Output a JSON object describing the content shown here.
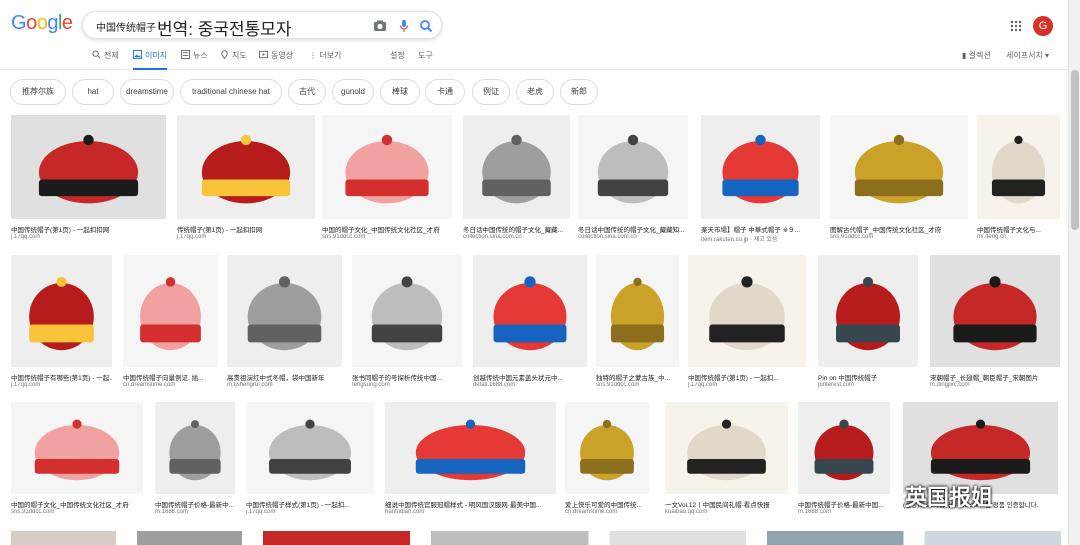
{
  "header": {
    "logo": "Google",
    "query_small": "中国传统帽子",
    "query_big": "번역: 중국전통모자",
    "avatar": "G",
    "icons": {
      "camera": "camera-icon",
      "mic": "mic-icon",
      "search": "search-icon",
      "apps": "apps-grid-icon"
    }
  },
  "tabs": [
    {
      "label": "전체",
      "icon": "search-icon"
    },
    {
      "label": "이미지",
      "icon": "image-icon"
    },
    {
      "label": "뉴스",
      "icon": "news-icon"
    },
    {
      "label": "지도",
      "icon": "pin-icon"
    },
    {
      "label": "동영상",
      "icon": "video-icon"
    },
    {
      "label": "더보기",
      "icon": "more-icon"
    }
  ],
  "settings_label": "설정",
  "tools_label": "도구",
  "collections_label": "컬렉션",
  "safesearch_label": "세이프서치 ▾",
  "chips": [
    "推荐尔族",
    "hat",
    "dreamstime",
    "traditional chinese hat",
    "古代",
    "gunold",
    "棒球",
    "卡通",
    "例证",
    "老虎",
    "新郎"
  ],
  "row1": [
    {
      "cap": "中国传统帽子(第1页) - 一起扣扣网",
      "src": "j.17qq.com"
    },
    {
      "cap": "传统帽子(第1页) - 一起扣扣网",
      "src": "j.17qq.com"
    },
    {
      "cap": "中国的帽子文化_中国传统文化社区_才府",
      "src": "sns.91ddcc.com"
    },
    {
      "cap": "冬日话中国传统的帽子文化_藏藏...",
      "src": "collection.sina.com.cn"
    },
    {
      "cap": "冬日话中国传统的帽子文化_藏藏知...",
      "src": "collection.sina.com.cn"
    },
    {
      "cap": "楽天市場】帽子 中華式帽子 ※９...",
      "src": "item.rakuten.co.jp · 재고 있음"
    },
    {
      "cap": "图解古代帽子_中国传统文化社区_才府",
      "src": "sns.91ddcc.com"
    },
    {
      "cap": "中国传统帽子文化与...",
      "src": "mr.ifeng.cn"
    }
  ],
  "row2": [
    {
      "cap": "中国传统帽子有哪些(第1页) - 一起...",
      "src": "j.17qq.com"
    },
    {
      "cap": "中国传统帽子向量例证. 插...",
      "src": "cn.dreamstime.com"
    },
    {
      "cap": "高贵祖演红中式冬帽，袋中国新年",
      "src": "m.tjshengrui.com"
    },
    {
      "cap": "张书同帽子的号探析传统中国...",
      "src": "fengsung.com"
    },
    {
      "cap": "创越传统中国元素盖头状元中...",
      "src": "detail.1688.com"
    },
    {
      "cap": "独特的帽子之蒙古族_中...",
      "src": "sns.91ddcc.com"
    },
    {
      "cap": "中国传统帽子(第1页) - 一起扣...",
      "src": "j.17qq.com"
    },
    {
      "cap": "Pin on 中国传统帽子",
      "src": "pinterest.com"
    },
    {
      "cap": "宋朝帽子_长翅帽_朝臣帽子_宋朝图片",
      "src": "m.dingjixc.com"
    }
  ],
  "row3": [
    {
      "cap": "中国的帽子文化_中国传统文化社区_才府",
      "src": "sns.91ddcc.com"
    },
    {
      "cap": "中国传统帽子价格-最新中...",
      "src": "m.1688.com"
    },
    {
      "cap": "中国传统帽子样式(第1页) - 一起扣...",
      "src": "j.17qq.com"
    },
    {
      "cap": "细说中国传统官服冠帽样式 - 明风国汉服网·最美中国...",
      "src": "hanfudian.com"
    },
    {
      "cap": "爱上快乐可爱的中国传统...",
      "src": "cn.dreamstime.com"
    },
    {
      "cap": "一文Vol.12丨中国民间礼帽-看点快报",
      "src": "kuaibao.qq.com"
    },
    {
      "cap": "中国传统帽子价格-最新中国...",
      "src": "m.1688.com"
    },
    {
      "cap": "(설정)으로 이동하여 Windows를 정품 인증합니다.",
      "src": ""
    }
  ],
  "watermark": "英国报姐",
  "colors": {
    "accent": "#1a73e8",
    "avatar_bg": "#d93025",
    "link_gray": "#5f6368"
  }
}
